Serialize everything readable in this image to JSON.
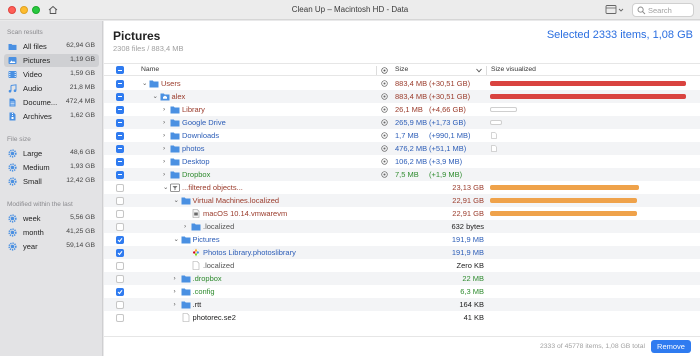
{
  "window": {
    "title": "Clean Up – Macintosh HD - Data"
  },
  "search": {
    "placeholder": "Search"
  },
  "sidebar": {
    "scan_header": "Scan results",
    "scan_items": [
      {
        "label": "All files",
        "size": "62,94 GB",
        "icon": "folder-icon"
      },
      {
        "label": "Pictures",
        "size": "1,19 GB",
        "icon": "picture-icon"
      },
      {
        "label": "Video",
        "size": "1,59 GB",
        "icon": "video-icon"
      },
      {
        "label": "Audio",
        "size": "21,8 MB",
        "icon": "music-note-icon"
      },
      {
        "label": "Docume...",
        "size": "472,4 MB",
        "icon": "document-icon"
      },
      {
        "label": "Archives",
        "size": "1,62 GB",
        "icon": "archive-icon"
      }
    ],
    "size_header": "File size",
    "size_items": [
      {
        "label": "Large",
        "size": "48,6 GB"
      },
      {
        "label": "Medium",
        "size": "1,93 GB"
      },
      {
        "label": "Small",
        "size": "12,42 GB"
      }
    ],
    "modified_header": "Modified within the last",
    "modified_items": [
      {
        "label": "week",
        "size": "5,56 GB"
      },
      {
        "label": "month",
        "size": "41,25 GB"
      },
      {
        "label": "year",
        "size": "59,14 GB"
      }
    ]
  },
  "main": {
    "title": "Pictures",
    "subtitle": "2308 files / 883,4 MB",
    "selected": "Selected 2333 items, 1,08 GB",
    "columns": {
      "name": "Name",
      "size": "Size",
      "visual": "Size visualized"
    }
  },
  "rows": [
    {
      "name": "Users",
      "size": "883,4 MB",
      "delta": "(+30,51 GB)",
      "check": "mix",
      "color": "red",
      "icon": "folder",
      "indent": 0,
      "disc": "open",
      "target": true,
      "bar": "red",
      "barLevel": 1.0
    },
    {
      "name": "alex",
      "size": "883,4 MB",
      "delta": "(+30,51 GB)",
      "check": "mix",
      "color": "red",
      "icon": "home",
      "indent": 1,
      "disc": "open",
      "target": true,
      "bar": "red",
      "barLevel": 1.0
    },
    {
      "name": "Library",
      "size": "26,1 MB",
      "delta": "(+4,66 GB)",
      "check": "mix",
      "color": "red",
      "icon": "folder",
      "indent": 2,
      "disc": "closed",
      "target": true,
      "bar": "empty",
      "barLevel": 0.14
    },
    {
      "name": "Google Drive",
      "size": "265,9 MB",
      "delta": "(+1,73 GB)",
      "check": "mix",
      "color": "blue",
      "icon": "folder",
      "indent": 2,
      "disc": "closed",
      "target": true,
      "bar": "empty",
      "barLevel": 0.06
    },
    {
      "name": "Downloads",
      "size": "1,7 MB",
      "delta": "(+990,1 MB)",
      "check": "mix",
      "color": "blue",
      "icon": "folder",
      "indent": 2,
      "disc": "closed",
      "target": true,
      "bar": "mini"
    },
    {
      "name": "photos",
      "size": "476,2 MB",
      "delta": "(+51,1 MB)",
      "check": "mix",
      "color": "blue",
      "icon": "folder",
      "indent": 2,
      "disc": "closed",
      "target": true,
      "bar": "mini"
    },
    {
      "name": "Desktop",
      "size": "106,2 MB",
      "delta": "(+3,9 MB)",
      "check": "mix",
      "color": "blue",
      "icon": "folder",
      "indent": 2,
      "disc": "closed",
      "target": true,
      "bar": "none"
    },
    {
      "name": "Dropbox",
      "size": "7,5 MB",
      "delta": "(+1,9 MB)",
      "check": "mix",
      "color": "green",
      "icon": "folder",
      "indent": 2,
      "disc": "closed",
      "target": true,
      "bar": "none"
    },
    {
      "name": "...filtered objects...",
      "size": "23,13 GB",
      "delta": "",
      "check": "off",
      "color": "red",
      "icon": "filter",
      "indent": 2,
      "disc": "open",
      "target": false,
      "bar": "orange",
      "barLevel": 0.76
    },
    {
      "name": "Virtual Machines.localized",
      "size": "22,91 GB",
      "delta": "",
      "check": "off",
      "color": "red",
      "icon": "folder",
      "indent": 3,
      "disc": "open",
      "target": false,
      "bar": "orange",
      "barLevel": 0.75
    },
    {
      "name": "macOS 10.14.vmwarevm",
      "size": "22,91 GB",
      "delta": "",
      "check": "off",
      "color": "red",
      "icon": "vm",
      "indent": 4,
      "disc": "none",
      "target": false,
      "bar": "orange",
      "barLevel": 0.75
    },
    {
      "name": ".localized",
      "size": "632 bytes",
      "delta": "",
      "check": "off",
      "color": "gray",
      "icon": "folder",
      "indent": 4,
      "disc": "closed",
      "target": false,
      "bar": "none"
    },
    {
      "name": "Pictures",
      "size": "191,9 MB",
      "delta": "",
      "check": "on",
      "color": "blue",
      "icon": "folder",
      "indent": 3,
      "disc": "open",
      "target": false,
      "bar": "none"
    },
    {
      "name": "Photos Library.photoslibrary",
      "size": "191,9 MB",
      "delta": "",
      "check": "on",
      "color": "blue",
      "icon": "photos",
      "indent": 4,
      "disc": "none",
      "target": false,
      "bar": "none"
    },
    {
      "name": ".localized",
      "size": "Zero KB",
      "delta": "",
      "check": "off",
      "color": "gray",
      "icon": "file",
      "indent": 4,
      "disc": "none",
      "target": false,
      "bar": "none"
    },
    {
      "name": ".dropbox",
      "size": "22 MB",
      "delta": "",
      "check": "off",
      "color": "green",
      "icon": "folder",
      "indent": 3,
      "disc": "closed",
      "target": false,
      "bar": "none"
    },
    {
      "name": ".config",
      "size": "6,3 MB",
      "delta": "",
      "check": "on",
      "color": "green",
      "icon": "folder",
      "indent": 3,
      "disc": "closed",
      "target": false,
      "bar": "none"
    },
    {
      "name": ".rtt",
      "size": "164 KB",
      "delta": "",
      "check": "off",
      "color": "black",
      "icon": "folder",
      "indent": 3,
      "disc": "closed",
      "target": false,
      "bar": "none"
    },
    {
      "name": "photorec.se2",
      "size": "41 KB",
      "delta": "",
      "check": "off",
      "color": "black",
      "icon": "file",
      "indent": 3,
      "disc": "none",
      "target": false,
      "bar": "none"
    }
  ],
  "footer": {
    "status": "2333 of 45778 items, 1,08 GB total",
    "remove_label": "Remove"
  },
  "colors": {
    "accent": "#2f7bf0",
    "folder": "#4a90e2",
    "bar_red": "#d9433f",
    "bar_orange": "#efa24a"
  }
}
